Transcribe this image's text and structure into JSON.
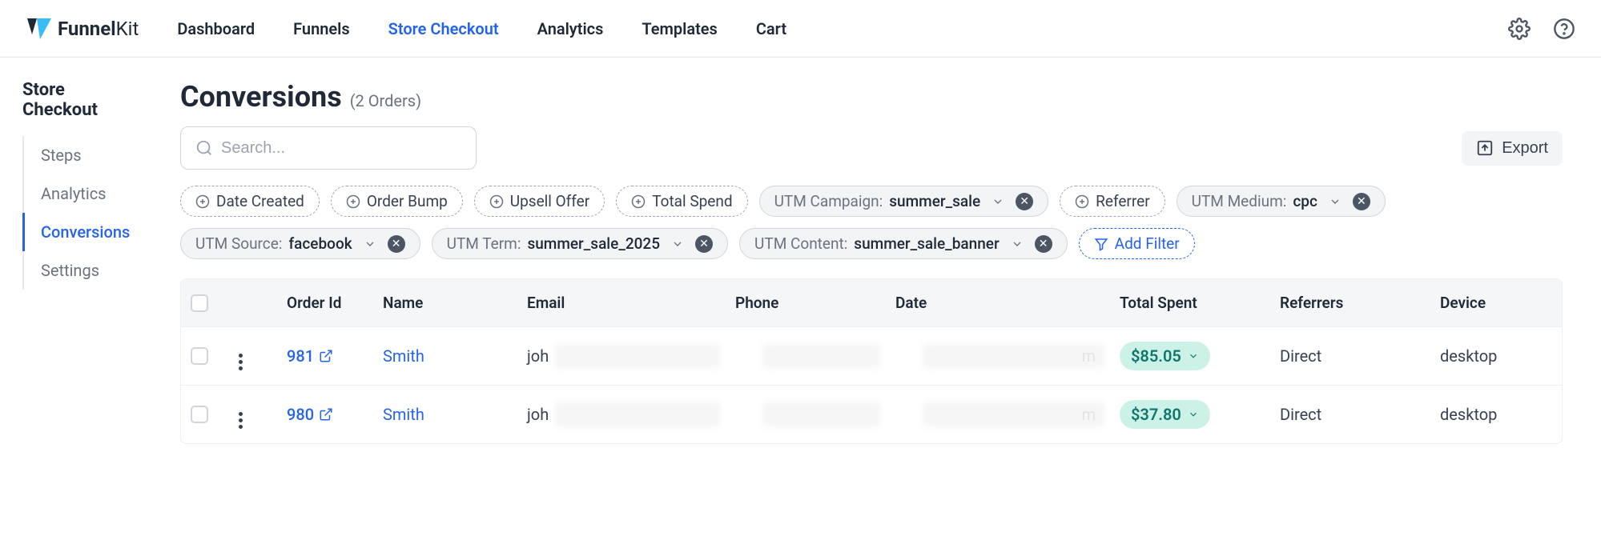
{
  "brand": {
    "name": "Funnel",
    "suffix": "Kit"
  },
  "nav": {
    "items": [
      {
        "label": "Dashboard"
      },
      {
        "label": "Funnels"
      },
      {
        "label": "Store Checkout",
        "active": true
      },
      {
        "label": "Analytics"
      },
      {
        "label": "Templates"
      },
      {
        "label": "Cart"
      }
    ]
  },
  "sidebar": {
    "title": "Store Checkout",
    "items": [
      {
        "label": "Steps"
      },
      {
        "label": "Analytics"
      },
      {
        "label": "Conversions",
        "active": true
      },
      {
        "label": "Settings"
      }
    ]
  },
  "page": {
    "title": "Conversions",
    "subtitle": "(2 Orders)"
  },
  "search": {
    "placeholder": "Search..."
  },
  "export_label": "Export",
  "filters": {
    "unapplied": [
      {
        "label": "Date Created"
      },
      {
        "label": "Order Bump"
      },
      {
        "label": "Upsell Offer"
      },
      {
        "label": "Total Spend"
      }
    ],
    "applied": [
      {
        "label": "UTM Campaign:",
        "value": "summer_sale"
      }
    ],
    "unapplied2": [
      {
        "label": "Referrer"
      }
    ],
    "applied2": [
      {
        "label": "UTM Medium:",
        "value": "cpc"
      },
      {
        "label": "UTM Source:",
        "value": "facebook"
      },
      {
        "label": "UTM Term:",
        "value": "summer_sale_2025"
      },
      {
        "label": "UTM Content:",
        "value": "summer_sale_banner"
      }
    ],
    "add_label": "Add Filter"
  },
  "table": {
    "headers": {
      "orderId": "Order Id",
      "name": "Name",
      "email": "Email",
      "phone": "Phone",
      "date": "Date",
      "totalSpent": "Total Spent",
      "referrers": "Referrers",
      "device": "Device"
    },
    "rows": [
      {
        "orderId": "981",
        "name": "Smith",
        "email_prefix": "joh",
        "date_suffix": "m",
        "totalSpent": "$85.05",
        "referrer": "Direct",
        "device": "desktop"
      },
      {
        "orderId": "980",
        "name": "Smith",
        "email_prefix": "joh",
        "date_suffix": "m",
        "totalSpent": "$37.80",
        "referrer": "Direct",
        "device": "desktop"
      }
    ]
  }
}
